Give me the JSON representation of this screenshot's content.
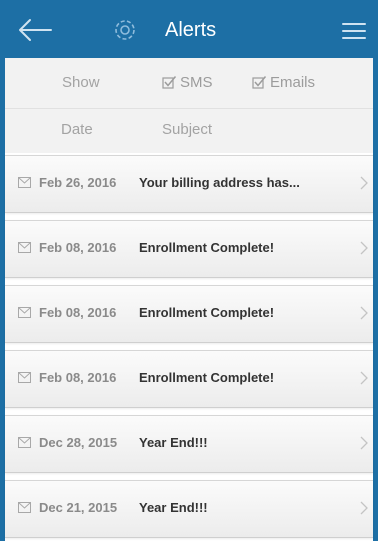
{
  "header": {
    "title": "Alerts",
    "accent": "#1d6fa5"
  },
  "icons": {
    "back": "arrow-left-icon",
    "settings": "gear-icon",
    "menu": "hamburger-icon"
  },
  "filters": {
    "show_label": "Show",
    "sms": {
      "label": "SMS",
      "checked": true
    },
    "emails": {
      "label": "Emails",
      "checked": true
    }
  },
  "columns": {
    "date": "Date",
    "subject": "Subject"
  },
  "alerts": [
    {
      "date": "Feb 26, 2016",
      "subject": "Your billing address has..."
    },
    {
      "date": "Feb 08, 2016",
      "subject": "Enrollment Complete!"
    },
    {
      "date": "Feb 08, 2016",
      "subject": "Enrollment Complete!"
    },
    {
      "date": "Feb 08, 2016",
      "subject": "Enrollment Complete!"
    },
    {
      "date": "Dec 28, 2015",
      "subject": "Year End!!!"
    },
    {
      "date": "Dec 21, 2015",
      "subject": "Year End!!!"
    }
  ]
}
